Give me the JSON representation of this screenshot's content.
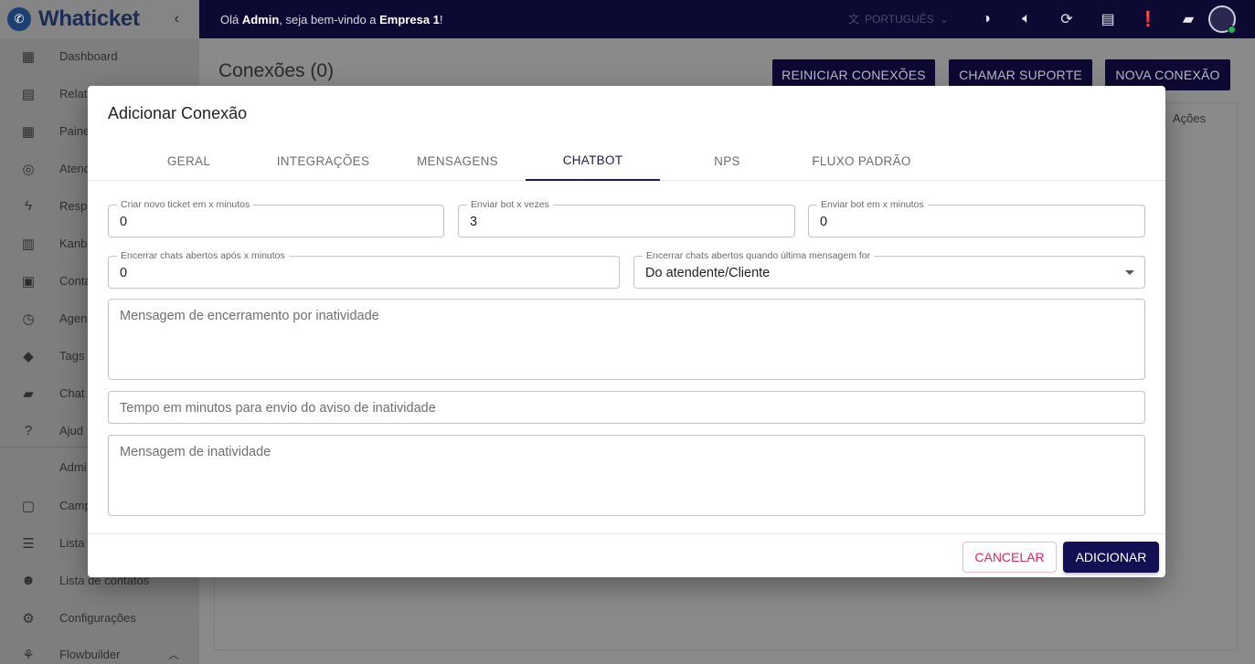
{
  "app": {
    "brand": "Whaticket",
    "greeting_prefix": "Olá ",
    "user": "Admin",
    "greeting_mid": ", seja bem-vindo a ",
    "company": "Empresa 1",
    "greeting_suffix": "!",
    "language": "PORTUGUÊS"
  },
  "sidebar": {
    "items": [
      {
        "label": "Dashboard",
        "icon": "dashboard-icon"
      },
      {
        "label": "Relat",
        "icon": "report-icon"
      },
      {
        "label": "Paine",
        "icon": "grid-icon"
      },
      {
        "label": "Atend",
        "icon": "whatsapp-icon"
      },
      {
        "label": "Resp",
        "icon": "bolt-icon"
      },
      {
        "label": "Kanb",
        "icon": "kanban-icon"
      },
      {
        "label": "Conta",
        "icon": "contacts-icon"
      },
      {
        "label": "Agen",
        "icon": "clock-icon"
      },
      {
        "label": "Tags",
        "icon": "tag-icon"
      },
      {
        "label": "Chat",
        "icon": "chat-icon"
      },
      {
        "label": "Ajud",
        "icon": "help-icon"
      }
    ],
    "admin_label": "Admi",
    "admin_items": [
      {
        "label": "Camp",
        "icon": "calendar-icon"
      },
      {
        "label": "Lista",
        "icon": "list-icon"
      },
      {
        "label": "Lista de contatos",
        "icon": "people-icon"
      },
      {
        "label": "Configurações",
        "icon": "settings-icon"
      },
      {
        "label": "Flowbuilder",
        "icon": "flow-icon"
      }
    ]
  },
  "page": {
    "title": "Conexões (0)",
    "buttons": {
      "restart": "REINICIAR CONEXÕES",
      "support": "CHAMAR SUPORTE",
      "new": "NOVA CONEXÃO"
    },
    "column_actions": "Ações"
  },
  "modal": {
    "title": "Adicionar Conexão",
    "tabs": [
      "GERAL",
      "INTEGRAÇÕES",
      "MENSAGENS",
      "CHATBOT",
      "NPS",
      "FLUXO PADRÃO"
    ],
    "active_tab": "CHATBOT",
    "fields": {
      "new_ticket_minutes": {
        "label": "Criar novo ticket em x minutos",
        "value": "0"
      },
      "send_bot_times": {
        "label": "Enviar bot x vezes",
        "value": "3"
      },
      "send_bot_minutes": {
        "label": "Enviar bot em x minutos",
        "value": "0"
      },
      "close_after_minutes": {
        "label": "Encerrar chats abertos após x minutos",
        "value": "0"
      },
      "close_when_last": {
        "label": "Encerrar chats abertos quando última mensagem for",
        "value": "Do atendente/Cliente"
      },
      "closing_message": {
        "placeholder": "Mensagem de encerramento por inatividade"
      },
      "inactivity_time": {
        "placeholder": "Tempo em minutos para envio do aviso de inatividade"
      },
      "inactivity_message": {
        "placeholder": "Mensagem de inatividade"
      }
    },
    "cancel_label": "CANCELAR",
    "add_label": "ADICIONAR"
  },
  "colors": {
    "primary": "#0c0a33",
    "accent": "#141054",
    "cancel": "#e0245e",
    "online": "#1fb84b"
  }
}
